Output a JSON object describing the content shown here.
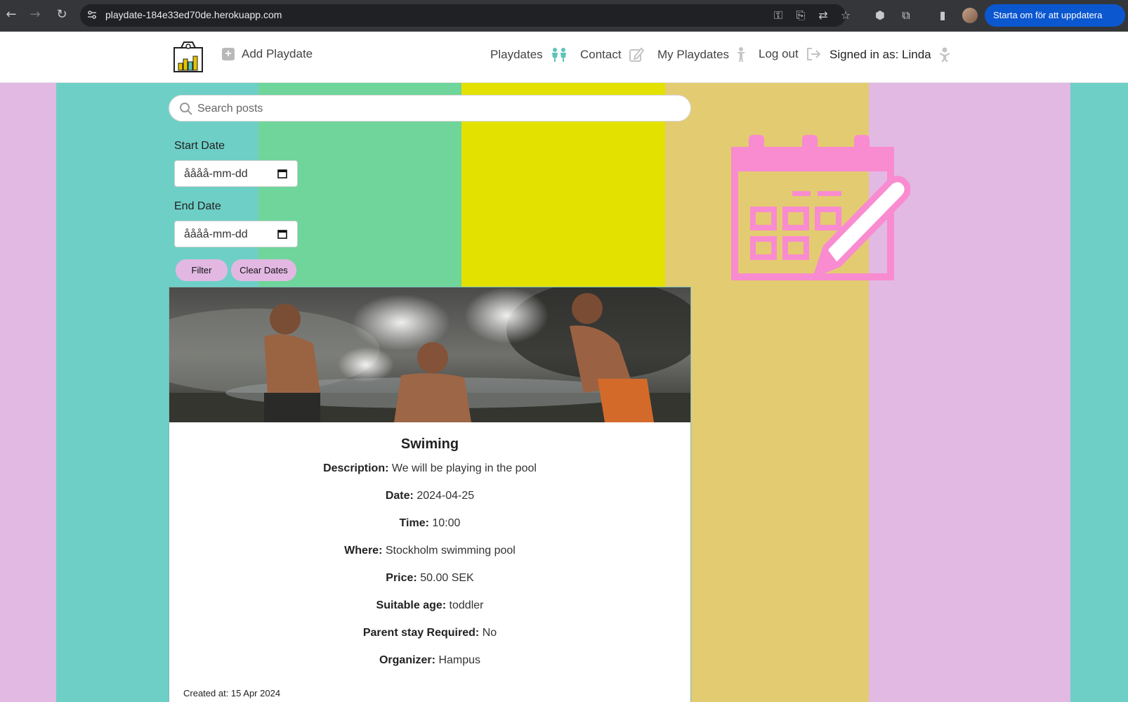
{
  "browser": {
    "url": "playdate-184e33ed70de.herokuapp.com",
    "update_button": "Starta om för att uppdatera"
  },
  "header": {
    "add_playdate": "Add Playdate",
    "nav": {
      "playdates": "Playdates",
      "contact": "Contact",
      "my_playdates": "My Playdates",
      "logout": "Log out",
      "signed_in": "Signed in as: Linda"
    }
  },
  "search": {
    "placeholder": "Search posts"
  },
  "filters": {
    "start_label": "Start Date",
    "start_value": "åååå-mm-dd",
    "end_label": "End Date",
    "end_value": "åååå-mm-dd",
    "filter_button": "Filter",
    "clear_button": "Clear Dates"
  },
  "post": {
    "title": "Swiming",
    "fields": [
      {
        "label": "Description:",
        "value": "We will be playing in the pool"
      },
      {
        "label": "Date:",
        "value": "2024-04-25"
      },
      {
        "label": "Time:",
        "value": "10:00"
      },
      {
        "label": "Where:",
        "value": "Stockholm swimming pool"
      },
      {
        "label": "Price:",
        "value": "50.00 SEK"
      },
      {
        "label": "Suitable age:",
        "value": "toddler"
      },
      {
        "label": "Parent stay Required:",
        "value": "No"
      },
      {
        "label": "Organizer:",
        "value": "Hampus"
      }
    ],
    "created": "Created at: 15 Apr 2024"
  },
  "colors": {
    "stripe_pink": "#e2b9e2",
    "stripe_teal": "#6ecfc7",
    "stripe_green": "#6fd59a",
    "stripe_yellow": "#e3e100",
    "stripe_gold": "#e3cb72",
    "accent_pink": "#f98bd0",
    "icon_teal": "#5bc4b8"
  }
}
